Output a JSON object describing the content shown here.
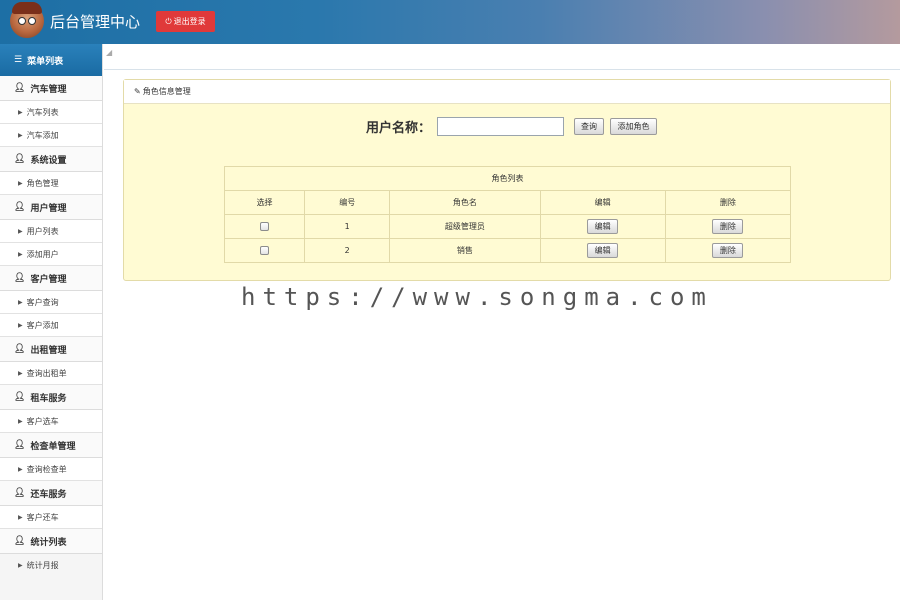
{
  "header": {
    "title": "后台管理中心",
    "logout_label": "退出登录"
  },
  "sidebar": {
    "heading": "菜单列表",
    "groups": [
      {
        "label": "汽车管理",
        "items": [
          "汽车列表",
          "汽车添加"
        ]
      },
      {
        "label": "系统设置",
        "items": [
          "角色管理"
        ]
      },
      {
        "label": "用户管理",
        "items": [
          "用户列表",
          "添加用户"
        ]
      },
      {
        "label": "客户管理",
        "items": [
          "客户查询",
          "客户添加"
        ]
      },
      {
        "label": "出租管理",
        "items": [
          "查询出租单"
        ]
      },
      {
        "label": "租车服务",
        "items": [
          "客户选车"
        ]
      },
      {
        "label": "检查单管理",
        "items": [
          "查询检查单"
        ]
      },
      {
        "label": "还车服务",
        "items": [
          "客户还车"
        ]
      },
      {
        "label": "统计列表",
        "items": [
          "统计月报"
        ]
      }
    ]
  },
  "panel": {
    "title": "角色信息管理",
    "search_label": "用户名称：",
    "search_value": "",
    "query_label": "查询",
    "add_label": "添加角色"
  },
  "table": {
    "caption": "角色列表",
    "columns": [
      "选择",
      "编号",
      "角色名",
      "编辑",
      "删除"
    ],
    "rows": [
      {
        "id": "1",
        "name": "超级管理员",
        "edit": "编辑",
        "delete": "删除"
      },
      {
        "id": "2",
        "name": "销售",
        "edit": "编辑",
        "delete": "删除"
      }
    ]
  },
  "watermark": "https://www.songma.com"
}
